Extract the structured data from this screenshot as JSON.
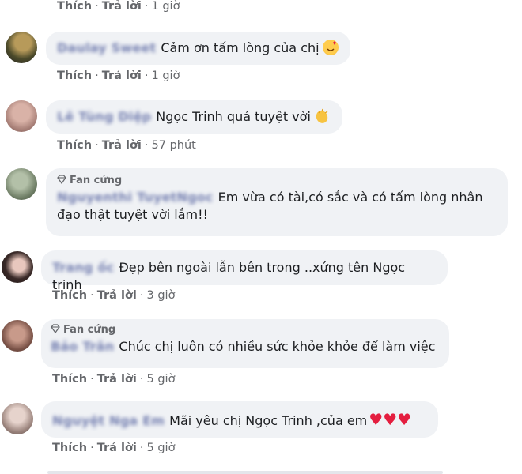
{
  "action_labels": {
    "like": "Thích",
    "reply": "Trả lời",
    "sep": "·"
  },
  "comments": [
    {
      "time": "1 giờ"
    },
    {
      "name": "Daulay Sweet",
      "text": "Cảm ơn tấm lòng của chị",
      "emoji": "heart-face-emoji",
      "time": "1 giờ"
    },
    {
      "name": "Lê Tùng Diệp",
      "text": "Ngọc Trinh quá tuyệt vời",
      "emoji": "clap-emoji",
      "time": "57 phút"
    },
    {
      "badge": "Fan cứng",
      "name": "Nguyenthi TuyetNgoc",
      "text": "Em vừa có tài,có sắc và có tấm lòng nhân đạo thật tuyệt vời lắm!!"
    },
    {
      "name": "Trang ốc",
      "text": "Đẹp bên ngoài lẫn bên trong ..xứng tên Ngọc trinh",
      "time": "3 giờ"
    },
    {
      "badge": "Fan cứng",
      "name": "Bảo Trân",
      "text": "Chúc chị luôn có nhiều sức khỏe khỏe để làm việc",
      "time": "5 giờ"
    },
    {
      "name": "Nguyệt Nga Em",
      "text": "Mãi yêu chị Ngọc Trinh ,của em",
      "hearts": "♥♥♥",
      "time": "5 giờ"
    }
  ],
  "colors": {
    "bubble": "#f0f2f5",
    "name": "#4c5a9a",
    "meta": "#65676b",
    "heart": "#e41e3f"
  }
}
